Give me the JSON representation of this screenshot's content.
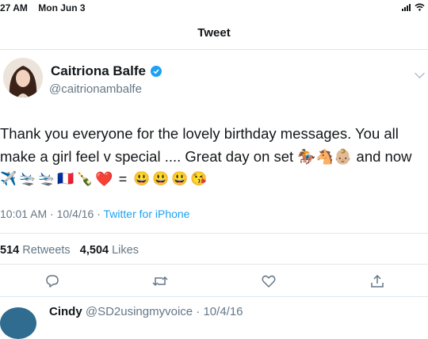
{
  "status_bar": {
    "time": "27 AM",
    "date": "Mon Jun 3"
  },
  "header": {
    "title": "Tweet"
  },
  "author": {
    "name": "Caitriona Balfe",
    "handle": "@caitrionambalfe"
  },
  "tweet": {
    "line1": "Thank you everyone for the lovely birthday messages. You all",
    "line2": "make a girl feel v special .... Great day on set 🏇🐴👶🏼 and now",
    "emoji_line": [
      "✈️",
      "🛬",
      "🛬",
      "🇫🇷",
      "🍾",
      "❤️",
      "=",
      "😃",
      "😃",
      "😃",
      "😘"
    ]
  },
  "meta": {
    "time": "10:01 AM",
    "date": "10/4/16",
    "separator": "·",
    "source": "Twitter for iPhone"
  },
  "stats": {
    "retweets_count": "514",
    "retweets_label": "Retweets",
    "likes_count": "4,504",
    "likes_label": "Likes"
  },
  "actions": [
    "reply-icon",
    "retweet-icon",
    "like-icon",
    "share-icon"
  ],
  "reply": {
    "name": "Cindy",
    "handle": "@SD2usingmyvoice",
    "separator": "·",
    "date": "10/4/16"
  },
  "colors": {
    "accent": "#1da1f2",
    "muted": "#657786",
    "divider": "#e1e8ed",
    "heart": "#e0245e"
  }
}
